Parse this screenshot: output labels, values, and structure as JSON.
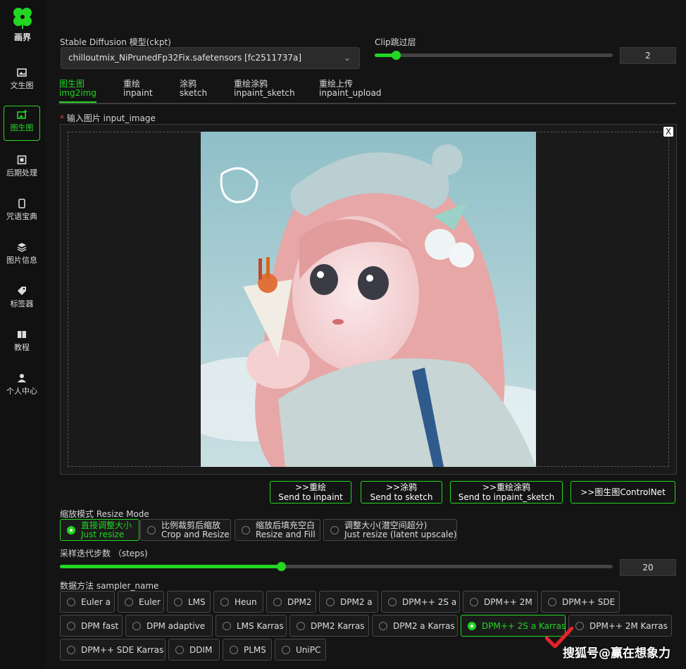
{
  "sidebar": {
    "logo_label": "画界",
    "items": [
      {
        "label": "文生图",
        "icon": "image-icon"
      },
      {
        "label": "图生图",
        "icon": "image-add-icon",
        "active": true
      },
      {
        "label": "后期处理",
        "icon": "square-icon"
      },
      {
        "label": "咒语宝典",
        "icon": "phone-icon"
      },
      {
        "label": "图片信息",
        "icon": "layers-icon"
      },
      {
        "label": "标签器",
        "icon": "tag-icon"
      },
      {
        "label": "教程",
        "icon": "book-icon"
      },
      {
        "label": "个人中心",
        "icon": "user-icon"
      }
    ]
  },
  "header": {
    "ckpt_label": "Stable Diffusion 模型(ckpt)",
    "ckpt_value": "chilloutmix_NiPrunedFp32Fix.safetensors [fc2511737a]",
    "clip_label": "Clip跳过层",
    "clip_value": "2",
    "clip_fraction": 0.09
  },
  "tabs": [
    {
      "cn": "图生图",
      "en": "img2img",
      "active": true
    },
    {
      "cn": "重绘",
      "en": "inpaint"
    },
    {
      "cn": "涂鸦",
      "en": "sketch"
    },
    {
      "cn": "重绘涂鸦",
      "en": "inpaint_sketch"
    },
    {
      "cn": "重绘上传",
      "en": "inpaint_upload"
    }
  ],
  "input_image": {
    "required_mark": "*",
    "label": "输入图片 input_image",
    "close_label": "X"
  },
  "send_buttons": [
    {
      "line1": ">>重绘",
      "line2": "Send to inpaint"
    },
    {
      "line1": ">>涂鸦",
      "line2": "Send to sketch"
    },
    {
      "line1": ">>重绘涂鸦",
      "line2": "Send to inpaint_sketch"
    },
    {
      "line1": ">>图生图ControlNet",
      "line2": ""
    }
  ],
  "resize_mode": {
    "label": "缩放模式 Resize Mode",
    "options": [
      {
        "cn": "直接调整大小",
        "en": "Just resize",
        "selected": true
      },
      {
        "cn": "比例裁剪后缩放",
        "en": "Crop and Resize"
      },
      {
        "cn": "缩放后填充空白",
        "en": "Resize and Fill"
      },
      {
        "cn": "调整大小(潜空间超分)",
        "en": "Just resize (latent upscale)"
      }
    ]
  },
  "steps": {
    "label": "采样迭代步数 （steps)",
    "value": "20",
    "fraction": 0.4
  },
  "sampler": {
    "label": "数据方法 sampler_name",
    "options": [
      "Euler a",
      "Euler",
      "LMS",
      "Heun",
      "DPM2",
      "DPM2 a",
      "DPM++ 2S a",
      "DPM++ 2M",
      "DPM++ SDE",
      "DPM fast",
      "DPM adaptive",
      "LMS Karras",
      "DPM2 Karras",
      "DPM2 a Karras",
      "DPM++ 2S a Karras",
      "DPM++ 2M Karras",
      "DPM++ SDE Karras",
      "DDIM",
      "PLMS",
      "UniPC"
    ],
    "selected": "DPM++ 2S a Karras"
  },
  "watermark": "搜狐号@赢在想象力",
  "colors": {
    "accent": "#22d622",
    "background": "#141414",
    "panel": "#2b2b2b"
  }
}
